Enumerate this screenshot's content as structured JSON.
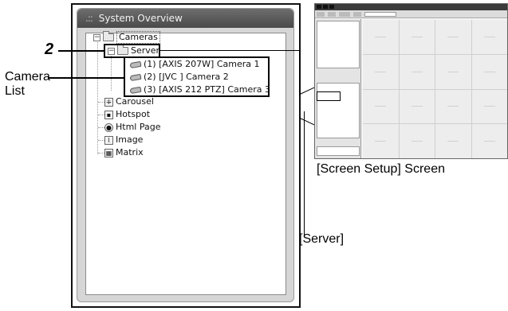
{
  "panel": {
    "grip": ".::",
    "title": "System Overview"
  },
  "tree": {
    "cameras_label": "Cameras",
    "server_label": "Server",
    "camera_list": [
      "(1) [AXIS 207W] Camera 1",
      "(2) [JVC ] Camera 2",
      "(3) [AXIS 212 PTZ] Camera 3"
    ],
    "other_items": [
      {
        "label": "Carousel",
        "icon": "carousel-icon"
      },
      {
        "label": "Hotspot",
        "icon": "hotspot-icon"
      },
      {
        "label": "Html Page",
        "icon": "html-page-icon"
      },
      {
        "label": "Image",
        "icon": "image-icon"
      },
      {
        "label": "Matrix",
        "icon": "matrix-icon"
      }
    ]
  },
  "annotations": {
    "step_number": "2",
    "camera_list_label_line1": "Camera",
    "camera_list_label_line2": "List",
    "screen_setup_label": "[Screen Setup] Screen",
    "server_label": "[Server]"
  }
}
